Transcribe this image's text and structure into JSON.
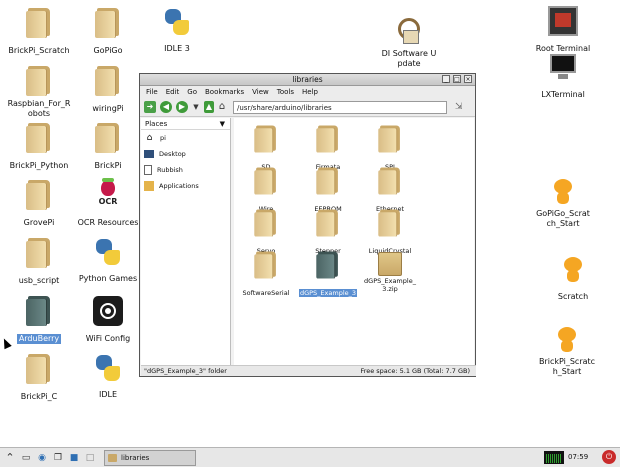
{
  "desktop": {
    "icons": [
      {
        "label": "BrickPi_Scratch"
      },
      {
        "label": "GoPiGo"
      },
      {
        "label": "IDLE 3"
      },
      {
        "label": "DI Software Update"
      },
      {
        "label": "Root Terminal"
      },
      {
        "label": "Raspbian_For_Robots"
      },
      {
        "label": "wiringPi"
      },
      {
        "label": "LXTerminal"
      },
      {
        "label": "BrickPi_Python"
      },
      {
        "label": "BrickPi"
      },
      {
        "label": "GrovePi"
      },
      {
        "label": "OCR Resources"
      },
      {
        "label": "GoPiGo_Scratch_Start"
      },
      {
        "label": "usb_script"
      },
      {
        "label": "Python Games"
      },
      {
        "label": "Scratch"
      },
      {
        "label": "ArduBerry"
      },
      {
        "label": "WiFi Config"
      },
      {
        "label": "BrickPi_Scratch_Start"
      },
      {
        "label": "BrickPi_C"
      },
      {
        "label": "IDLE"
      }
    ],
    "ocr_text": "OCR"
  },
  "window": {
    "title": "libraries",
    "buttons": {
      "minimize": "_",
      "maximize": "□",
      "close": "×"
    },
    "menu": [
      "File",
      "Edit",
      "Go",
      "Bookmarks",
      "View",
      "Tools",
      "Help"
    ],
    "path": "/usr/share/arduino/libraries",
    "places_label": "Places",
    "places": [
      {
        "label": "pi",
        "icon": "home-icon"
      },
      {
        "label": "Desktop",
        "icon": "desktop-icon"
      },
      {
        "label": "Rubbish",
        "icon": "trash-icon"
      },
      {
        "label": "Applications",
        "icon": "applications-icon"
      }
    ],
    "files": [
      {
        "label": "SD"
      },
      {
        "label": "Firmata"
      },
      {
        "label": "SPI"
      },
      {
        "label": "Wire"
      },
      {
        "label": "EEPROM"
      },
      {
        "label": "Ethernet"
      },
      {
        "label": "Servo"
      },
      {
        "label": "Stepper"
      },
      {
        "label": "LiquidCrystal"
      },
      {
        "label": "SoftwareSerial"
      },
      {
        "label": "dGPS_Example_3"
      },
      {
        "label": "dGPS_Example_3.zip"
      }
    ],
    "status_left": "\"dGPS_Example_3\" folder",
    "status_right": "Free space: 5.1 GB (Total: 7.7 GB)"
  },
  "taskbar": {
    "task_label": "libraries",
    "clock": "07:59"
  },
  "colors": {
    "selection": "#5a8fd2",
    "folder": "#d9bd86",
    "dark_folder": "#4b6463"
  }
}
